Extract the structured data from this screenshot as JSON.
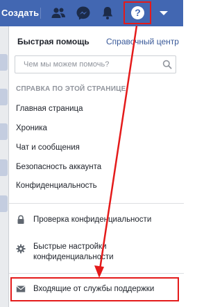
{
  "topbar": {
    "create_label": "Создать",
    "icons": [
      "friends-icon",
      "messenger-icon",
      "notifications-icon",
      "help-icon",
      "account-menu-caret-icon"
    ],
    "help_icon_glyph": "?"
  },
  "help_panel": {
    "title": "Быстрая помощь",
    "help_center_link": "Справочный центр",
    "search": {
      "placeholder": "Чем мы можем помочь?",
      "value": ""
    },
    "section_header": "СПРАВКА ПО ЭТОЙ СТРАНИЦЕ",
    "topics": [
      "Главная страница",
      "Хроника",
      "Чат и сообщения",
      "Безопасность аккаунта",
      "Конфиденциальность"
    ],
    "actions": [
      {
        "label": "Проверка конфиденциальности",
        "icon": "lock-icon"
      },
      {
        "label_line1": "Быстрые настройки",
        "label_line2": "конфиденциальности",
        "icon": "gear-icon"
      },
      {
        "label": "Входящие от службы поддержки",
        "icon": "envelope-icon"
      }
    ]
  },
  "colors": {
    "topbar_bg": "#4267b2",
    "link": "#385898",
    "annotation_red": "#e41a1a",
    "section_header": "#90949c"
  }
}
